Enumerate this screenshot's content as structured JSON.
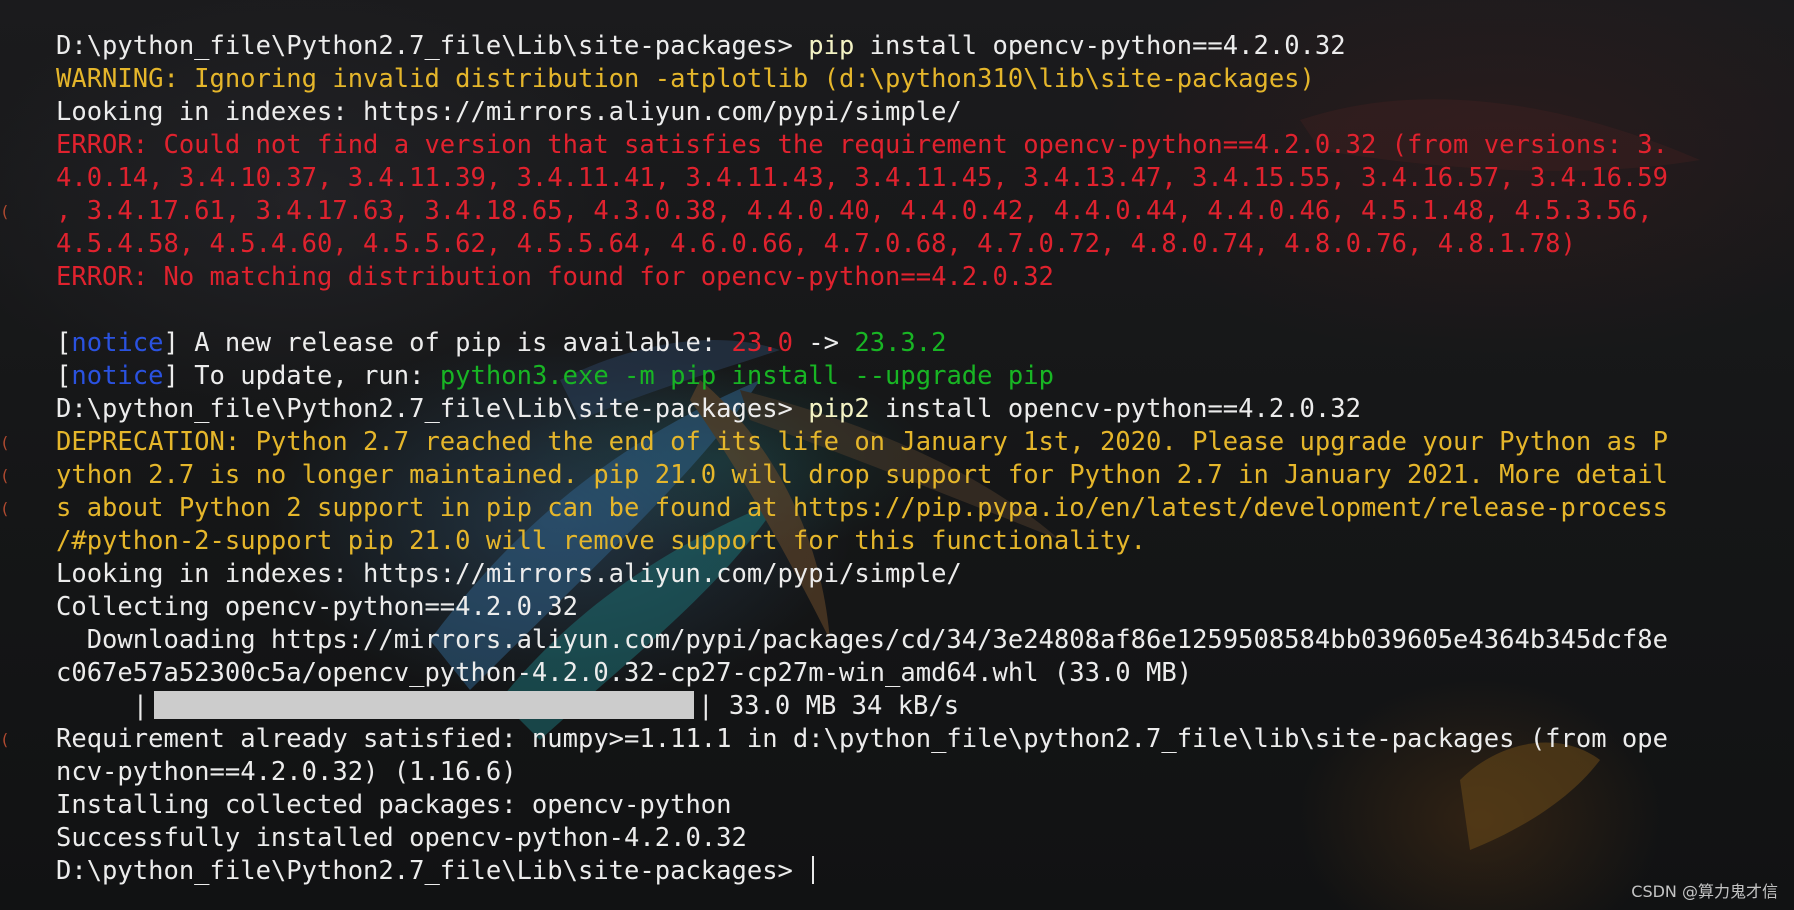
{
  "terminal": {
    "lines": [
      [
        {
          "t": "D:\\python_file\\Python2.7_file\\Lib\\site-packages> ",
          "c": "white"
        },
        {
          "t": "pip",
          "c": "cmd"
        },
        {
          "t": " install opencv-python==4.2.0.32",
          "c": "white"
        }
      ],
      [
        {
          "t": "WARNING: Ignoring invalid distribution -atplotlib (d:\\python310\\lib\\site-packages)",
          "c": "yellow"
        }
      ],
      [
        {
          "t": "Looking in indexes: https://mirrors.aliyun.com/pypi/simple/",
          "c": "white"
        }
      ],
      [
        {
          "t": "ERROR: Could not find a version that satisfies the requirement opencv-python==4.2.0.32 (from versions: 3.",
          "c": "red"
        }
      ],
      [
        {
          "t": "4.0.14, 3.4.10.37, 3.4.11.39, 3.4.11.41, 3.4.11.43, 3.4.11.45, 3.4.13.47, 3.4.15.55, 3.4.16.57, 3.4.16.59",
          "c": "red"
        }
      ],
      [
        {
          "t": ", 3.4.17.61, 3.4.17.63, 3.4.18.65, 4.3.0.38, 4.4.0.40, 4.4.0.42, 4.4.0.44, 4.4.0.46, 4.5.1.48, 4.5.3.56, ",
          "c": "red"
        }
      ],
      [
        {
          "t": "4.5.4.58, 4.5.4.60, 4.5.5.62, 4.5.5.64, 4.6.0.66, 4.7.0.68, 4.7.0.72, 4.8.0.74, 4.8.0.76, 4.8.1.78)",
          "c": "red"
        }
      ],
      [
        {
          "t": "ERROR: No matching distribution found for opencv-python==4.2.0.32",
          "c": "red"
        }
      ],
      [],
      [
        {
          "t": "[",
          "c": "white"
        },
        {
          "t": "notice",
          "c": "blue"
        },
        {
          "t": "] A new release of pip is available: ",
          "c": "white"
        },
        {
          "t": "23.0",
          "c": "red"
        },
        {
          "t": " -> ",
          "c": "white"
        },
        {
          "t": "23.3.2",
          "c": "green"
        }
      ],
      [
        {
          "t": "[",
          "c": "white"
        },
        {
          "t": "notice",
          "c": "blue"
        },
        {
          "t": "] To update, run: ",
          "c": "white"
        },
        {
          "t": "python3.exe -m pip install --upgrade pip",
          "c": "green"
        }
      ],
      [
        {
          "t": "D:\\python_file\\Python2.7_file\\Lib\\site-packages> ",
          "c": "white"
        },
        {
          "t": "pip2",
          "c": "cmd"
        },
        {
          "t": " install opencv-python==4.2.0.32",
          "c": "white"
        }
      ],
      [
        {
          "t": "DEPRECATION: Python 2.7 reached the end of its life on January 1st, 2020. Please upgrade your Python as P",
          "c": "yellow"
        }
      ],
      [
        {
          "t": "ython 2.7 is no longer maintained. pip 21.0 will drop support for Python 2.7 in January 2021. More detail",
          "c": "yellow"
        }
      ],
      [
        {
          "t": "s about Python 2 support in pip can be found at https://pip.pypa.io/en/latest/development/release-process",
          "c": "yellow"
        }
      ],
      [
        {
          "t": "/#python-2-support pip 21.0 will remove support for this functionality.",
          "c": "yellow"
        }
      ],
      [
        {
          "t": "Looking in indexes: https://mirrors.aliyun.com/pypi/simple/",
          "c": "white"
        }
      ],
      [
        {
          "t": "Collecting opencv-python==4.2.0.32",
          "c": "white"
        }
      ],
      [
        {
          "t": "  Downloading https://mirrors.aliyun.com/pypi/packages/cd/34/3e24808af86e1259508584bb039605e4364b345dcf8e",
          "c": "white"
        }
      ],
      [
        {
          "t": "c067e57a52300c5a/opencv_python-4.2.0.32-cp27-cp27m-win_amd64.whl (33.0 MB)",
          "c": "white"
        }
      ],
      [
        {
          "t": "     |",
          "c": "white"
        },
        {
          "progress": "1.0"
        },
        {
          "t": "| 33.0 MB 34 kB/s",
          "c": "white"
        }
      ],
      [
        {
          "t": "Requirement already satisfied: numpy>=1.11.1 in d:\\python_file\\python2.7_file\\lib\\site-packages (from ope",
          "c": "white"
        }
      ],
      [
        {
          "t": "ncv-python==4.2.0.32) (1.16.6)",
          "c": "white"
        }
      ],
      [
        {
          "t": "Installing collected packages: opencv-python",
          "c": "white"
        }
      ],
      [
        {
          "t": "Successfully installed opencv-python-4.2.0.32",
          "c": "white"
        }
      ],
      [
        {
          "t": "D:\\python_file\\Python2.7_file\\Lib\\site-packages> ",
          "c": "white"
        },
        {
          "cursor": "1"
        }
      ]
    ],
    "edge_marks": [
      "",
      "",
      "",
      "",
      "",
      "(",
      "",
      "",
      "",
      "",
      "",
      "",
      "(",
      "(",
      "(",
      "",
      "",
      "",
      "",
      "",
      "",
      "(",
      "",
      "",
      "",
      ""
    ],
    "colors": {
      "background": "#161617",
      "text": "#ececec",
      "warning": "#e5b62b",
      "error": "#e0222e",
      "success": "#18b524",
      "notice": "#2a52e0",
      "command": "#f3f3c4",
      "progress": "#cccccc"
    }
  },
  "watermark": "CSDN @算力鬼才信"
}
